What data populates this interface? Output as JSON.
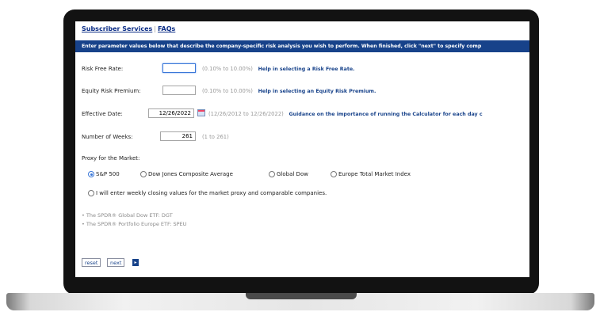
{
  "nav": {
    "subscriber_services": "Subscriber Services",
    "separator": "|",
    "faqs": "FAQs"
  },
  "banner": "Enter parameter values below that describe the company-specific risk analysis you wish to perform. When finished, click \"next\" to specify comp",
  "fields": {
    "risk_free_rate": {
      "label": "Risk Free Rate:",
      "value": "",
      "range": "(0.10% to 10.00%)",
      "help": "Help in selecting a Risk Free Rate."
    },
    "equity_risk_premium": {
      "label": "Equity Risk Premium:",
      "value": "",
      "range": "(0.10% to 10.00%)",
      "help": "Help in selecting an Equity Risk Premium."
    },
    "effective_date": {
      "label": "Effective Date:",
      "value": "12/26/2022",
      "range": "(12/26/2012 to 12/26/2022)",
      "help": "Guidance on the importance of running the Calculator for each day c"
    },
    "number_of_weeks": {
      "label": "Number of Weeks:",
      "value": "261",
      "range": "(1 to 261)"
    }
  },
  "proxy": {
    "label": "Proxy for the Market:",
    "options": [
      "S&P 500",
      "Dow Jones Composite Average",
      "Global Dow",
      "Europe Total Market Index"
    ],
    "selected": "S&P 500",
    "manual_option": "I will enter weekly closing values for the market proxy and comparable companies."
  },
  "notes": [
    "The SPDR® Global Dow ETF: DGT",
    "The SPDR® Portfolio Europe ETF: SPEU"
  ],
  "buttons": {
    "reset": "reset",
    "next": "next"
  },
  "icons": {
    "calendar": "calendar-icon",
    "next_arrow": "chevron-right-icon"
  }
}
